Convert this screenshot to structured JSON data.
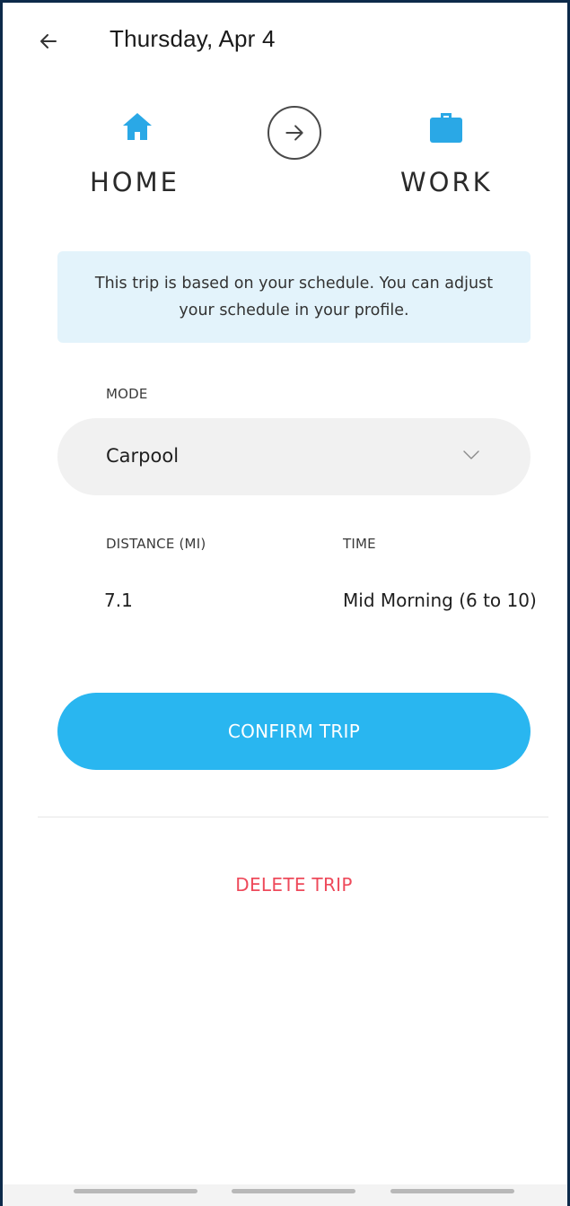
{
  "header": {
    "title": "Thursday, Apr 4"
  },
  "route": {
    "from_label": "HOME",
    "to_label": "WORK"
  },
  "info": {
    "message": "This trip is based on your schedule. You can adjust your schedule in your profile."
  },
  "mode": {
    "label": "MODE",
    "value": "Carpool"
  },
  "distance": {
    "label": "DISTANCE (MI)",
    "value": "7.1"
  },
  "time": {
    "label": "TIME",
    "value": "Mid Morning (6 to 10)"
  },
  "actions": {
    "confirm_label": "CONFIRM TRIP",
    "delete_label": "DELETE TRIP"
  },
  "colors": {
    "accent": "#29b6f0",
    "danger": "#ee4a5b",
    "info_bg": "#e3f3fb"
  }
}
